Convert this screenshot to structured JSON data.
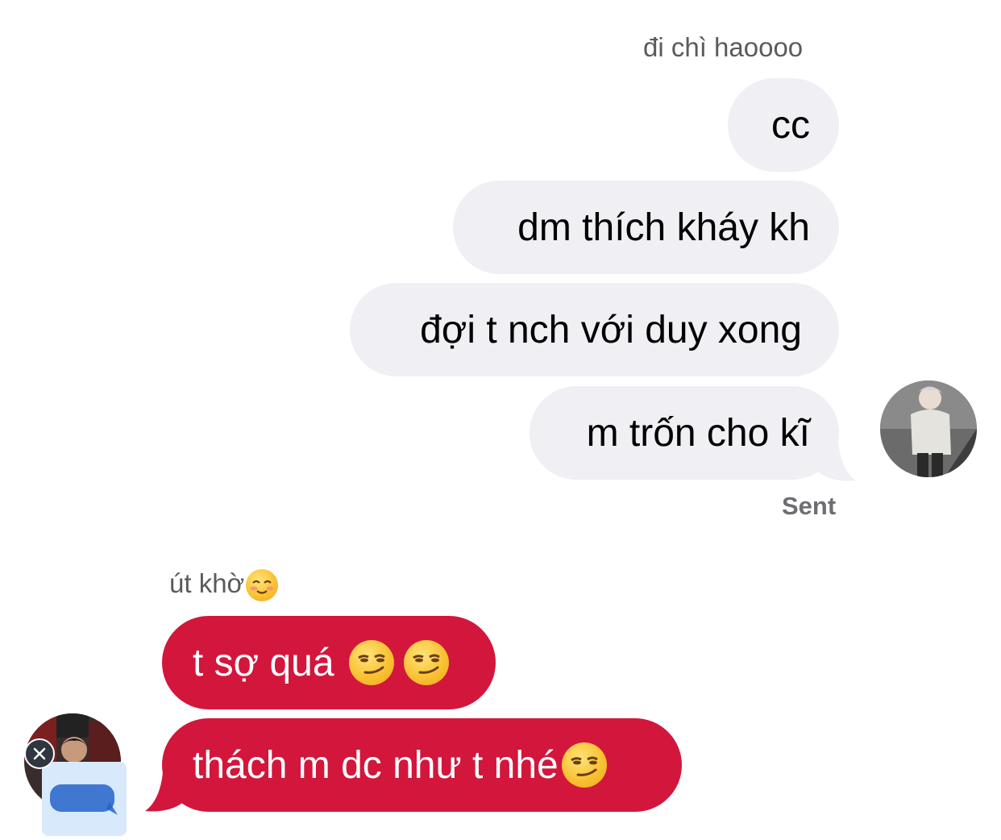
{
  "conversation": {
    "sender_me": {
      "name": "đi chì haoooo",
      "messages": [
        {
          "text": "cc"
        },
        {
          "text": "dm thích kháy kh"
        },
        {
          "text": "đợi t nch với duy xong"
        },
        {
          "text": "m trốn cho kĩ"
        }
      ],
      "status": "Sent"
    },
    "sender_other": {
      "name": "út khờ",
      "name_emoji": "smiling-blush-emoji",
      "messages": [
        {
          "text": "t sợ quá",
          "emojis": [
            "smirk-emoji",
            "smirk-emoji"
          ]
        },
        {
          "text": "thách m dc như t nhé",
          "emojis": [
            "smirk-emoji"
          ]
        }
      ]
    }
  },
  "colors": {
    "outgoing_bubble": "#efeff4",
    "incoming_bubble": "#d3163c",
    "meta_text": "#6d6d72"
  }
}
